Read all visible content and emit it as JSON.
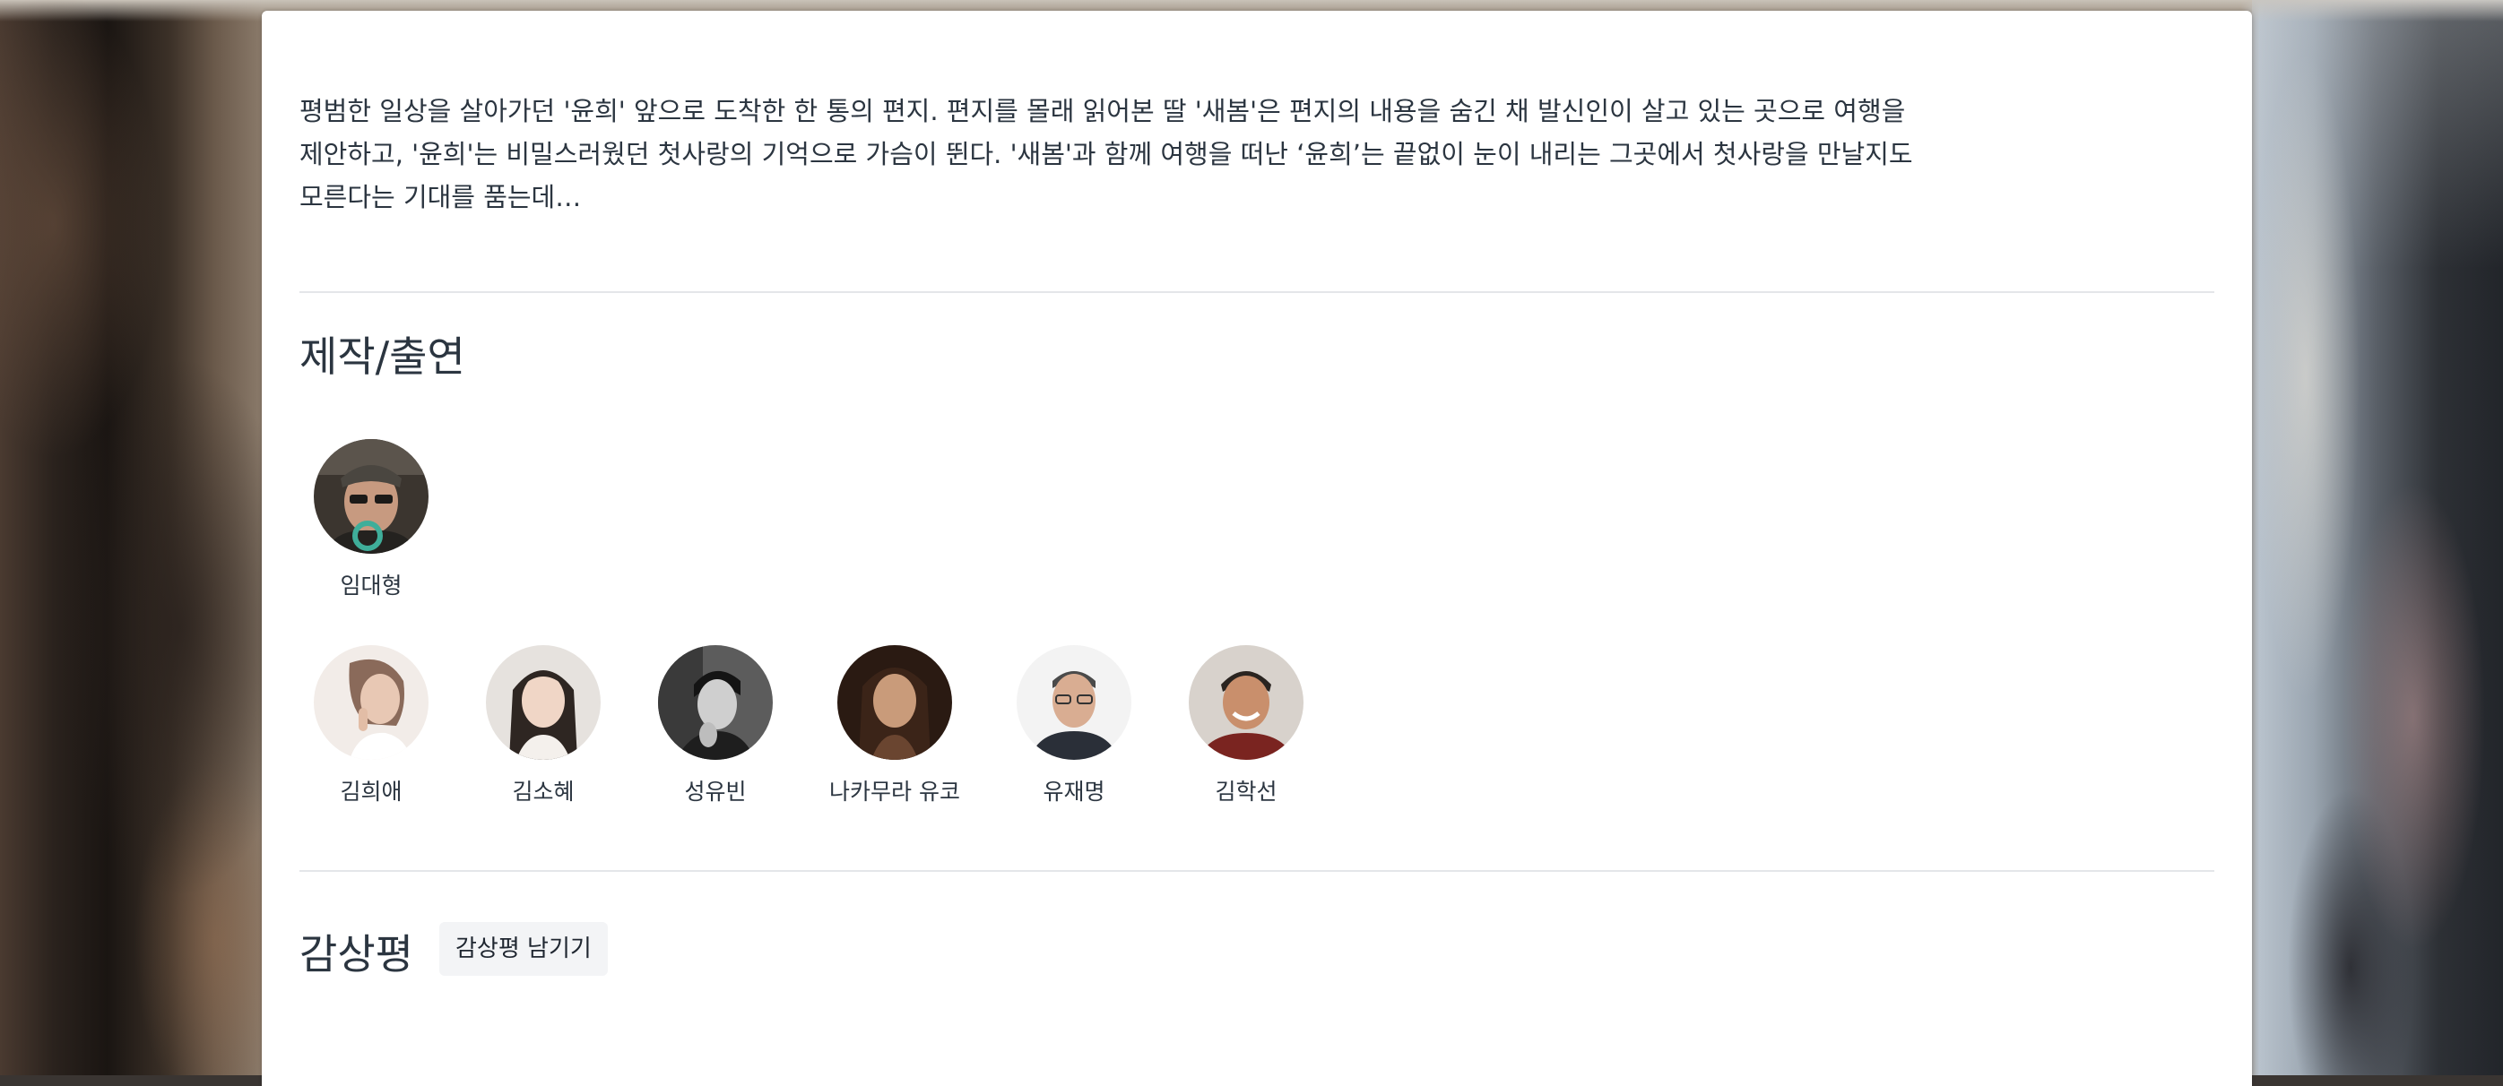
{
  "synopsis": {
    "text": "평범한 일상을 살아가던 '윤희' 앞으로 도착한 한 통의 편지. 편지를 몰래 읽어본 딸 '새봄'은 편지의 내용을 숨긴 채 발신인이 살고 있는 곳으로 여행을 제안하고, '윤희'는 비밀스러웠던 첫사랑의 기억으로 가슴이 뛴다. '새봄'과 함께 여행을 떠난 ‘윤희’는 끝없이 눈이 내리는 그곳에서 첫사랑을 만날지도 모른다는 기대를 품는데…"
  },
  "credits": {
    "title": "제작/출연",
    "directors": [
      {
        "name": "임대형",
        "photo": "director-photo"
      }
    ],
    "cast": [
      {
        "name": "김희애",
        "photo": "actor-photo"
      },
      {
        "name": "김소혜",
        "photo": "actor-photo"
      },
      {
        "name": "성유빈",
        "photo": "actor-photo"
      },
      {
        "name": "나카무라 유코",
        "photo": "actor-photo"
      },
      {
        "name": "유재명",
        "photo": "actor-photo"
      },
      {
        "name": "김학선",
        "photo": "actor-photo"
      }
    ]
  },
  "reviews": {
    "title": "감상평",
    "write_button_label": "감상평 남기기"
  },
  "colors": {
    "text": "#2b3540",
    "divider": "#e4e6e9",
    "button_bg": "#f3f4f6"
  }
}
